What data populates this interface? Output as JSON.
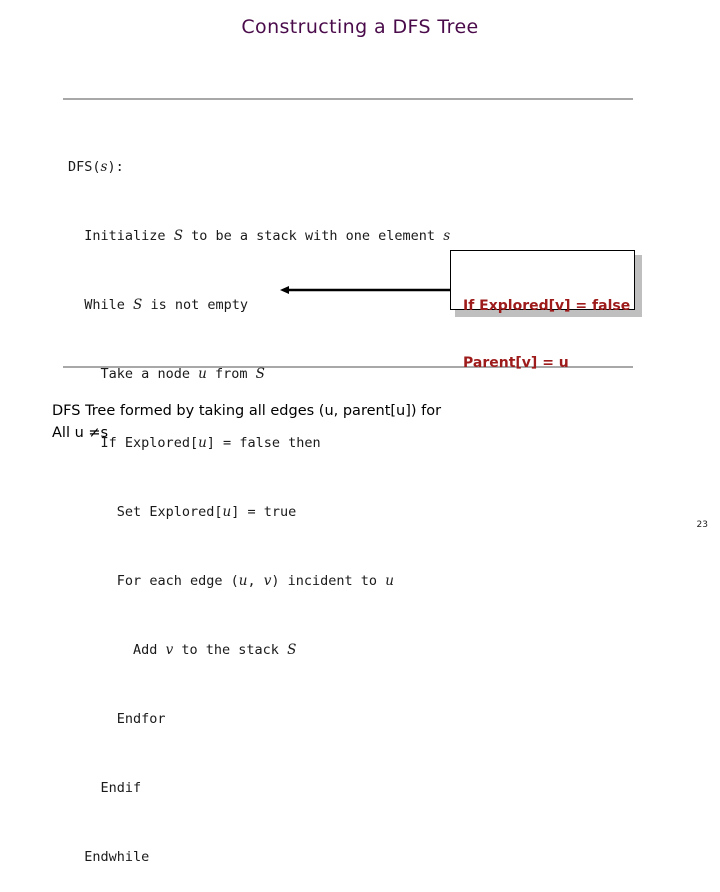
{
  "slide": {
    "title": "Constructing a DFS Tree",
    "title_color": "#4a0b4a",
    "page_number": "23",
    "background_color": "#ffffff"
  },
  "rules": {
    "color": "#a8a8a8",
    "top_label": "horizontal-rule-top",
    "bottom_label": "horizontal-rule-bottom"
  },
  "pseudocode": {
    "language": "DFS algorithm pseudocode",
    "lines": [
      "DFS(s):",
      "  Initialize S to be a stack with one element s",
      "  While S is not empty",
      "    Take a node u from S",
      "    If Explored[u] = false then",
      "      Set Explored[u] = true",
      "      For each edge (u, v) incident to u",
      "        Add v to the stack S",
      "      Endfor",
      "    Endif",
      "  Endwhile"
    ]
  },
  "callout": {
    "lines": [
      "If Explored[v] = false",
      "Parent[v] = u"
    ],
    "text_color": "#9e1b1b",
    "border_color": "#000000",
    "shadow_color": "#bfbfbf",
    "arrow_color": "#000000",
    "arrow_direction": "left"
  },
  "caption": {
    "lines": [
      "DFS Tree formed by taking all edges (u, parent[u]) for",
      "All u ≠s"
    ]
  }
}
